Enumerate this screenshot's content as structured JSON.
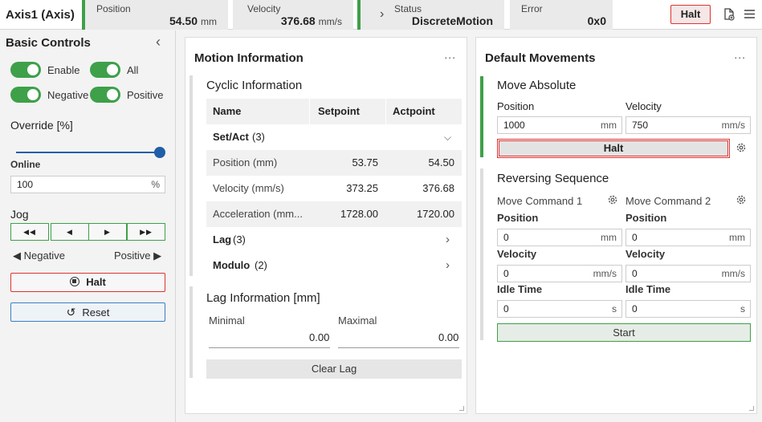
{
  "header": {
    "title": "Axis1 (Axis)",
    "position": {
      "label": "Position",
      "value": "54.50",
      "unit": "mm"
    },
    "velocity": {
      "label": "Velocity",
      "value": "376.68",
      "unit": "mm/s"
    },
    "status": {
      "label": "Status",
      "value": "DiscreteMotion",
      "chevron": "›"
    },
    "error": {
      "label": "Error",
      "value": "0x0"
    },
    "halt_label": "Halt",
    "accent": "#3ea049",
    "danger": "#d33333"
  },
  "sidebar": {
    "title": "Basic Controls",
    "collapse_icon": "‹",
    "enable_label": "Enable",
    "all_label": "All",
    "negative_label": "Negative",
    "positive_label": "Positive",
    "override_title": "Override [%]",
    "override_value": 100,
    "online_label": "Online",
    "online_value": "100",
    "online_unit": "%",
    "jog_title": "Jog",
    "jog_buttons": [
      "◀◀",
      "◀",
      "▶",
      "▶▶"
    ],
    "jog_negative": "◀ Negative",
    "jog_positive": "Positive ▶",
    "halt_label": "Halt",
    "reset_label": "Reset"
  },
  "motion": {
    "title": "Motion Information",
    "menu": "...",
    "cyclic_title": "Cyclic Information",
    "columns": [
      "Name",
      "Setpoint",
      "Actpoint"
    ],
    "setact_label": "Set/Act",
    "setact_count": "(3)",
    "rows": [
      {
        "name": "Position (mm)",
        "setpoint": "53.75",
        "actpoint": "54.50"
      },
      {
        "name": "Velocity (mm/s)",
        "setpoint": "373.25",
        "actpoint": "376.68"
      },
      {
        "name": "Acceleration (mm...",
        "setpoint": "1728.00",
        "actpoint": "1720.00"
      }
    ],
    "lag_label": "Lag",
    "lag_count": "(3)",
    "modulo_label": "Modulo",
    "modulo_count": "(2)",
    "lag_title": "Lag Information [mm]",
    "minimal_label": "Minimal",
    "minimal_value": "0.00",
    "maximal_label": "Maximal",
    "maximal_value": "0.00",
    "clear_label": "Clear Lag"
  },
  "movements": {
    "title": "Default Movements",
    "menu": "...",
    "absolute_title": "Move Absolute",
    "position_label": "Position",
    "position_value": "1000",
    "position_unit": "mm",
    "velocity_label": "Velocity",
    "velocity_value": "750",
    "velocity_unit": "mm/s",
    "halt_label": "Halt",
    "reversing_title": "Reversing Sequence",
    "cmd1_label": "Move Command 1",
    "cmd2_label": "Move Command 2",
    "cmd1": {
      "position": "0",
      "position_unit": "mm",
      "velocity": "0",
      "velocity_unit": "mm/s",
      "idle": "0",
      "idle_unit": "s"
    },
    "cmd2": {
      "position": "0",
      "position_unit": "mm",
      "velocity": "0",
      "velocity_unit": "mm/s",
      "idle": "0",
      "idle_unit": "s"
    },
    "idle_label": "Idle Time",
    "start_label": "Start"
  }
}
